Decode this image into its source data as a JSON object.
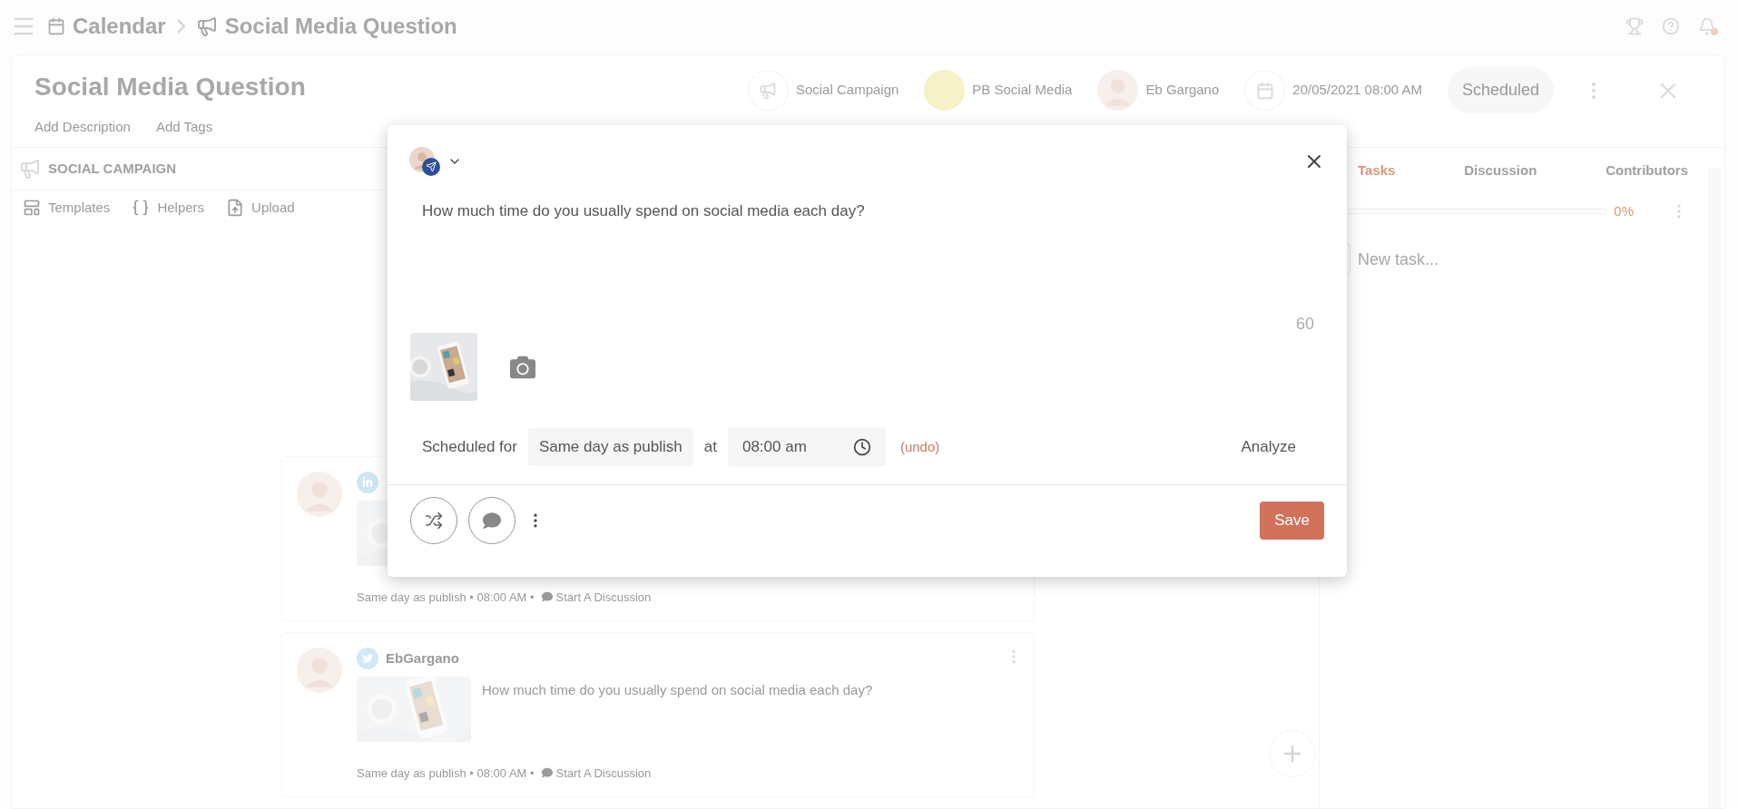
{
  "breadcrumb": [
    {
      "kind": "calendar",
      "label": "Calendar"
    },
    {
      "kind": "campaign",
      "label": "Social Media Question"
    }
  ],
  "page": {
    "title": "Social Media Question",
    "links": [
      "Add Description",
      "Add Tags"
    ]
  },
  "header_chips": [
    {
      "kind": "campaign",
      "label": "Social Campaign"
    },
    {
      "kind": "swatch",
      "label": "PB Social Media"
    },
    {
      "kind": "person",
      "label": "Eb Gargano"
    },
    {
      "kind": "date",
      "label": "20/05/2021 08:00 AM"
    }
  ],
  "status": "Scheduled",
  "section": {
    "title": "SOCIAL CAMPAIGN",
    "tools": [
      {
        "kind": "templates",
        "label": "Templates"
      },
      {
        "kind": "helpers",
        "label": "Helpers"
      },
      {
        "kind": "upload",
        "label": "Upload"
      }
    ]
  },
  "right_panel": {
    "tabs": [
      {
        "label": "Tasks",
        "selected": true
      },
      {
        "label": "Discussion",
        "selected": false
      },
      {
        "label": "Contributors",
        "selected": false
      }
    ],
    "progress": {
      "level": 0,
      "reading": "0%"
    },
    "new_task": {
      "checked": false,
      "placeholder": "New task..."
    }
  },
  "posts": [
    {
      "kind": "linkedin",
      "when": "Same day as publish • 08:00 AM •",
      "discuss": "Start A Discussion"
    },
    {
      "kind": "twitter",
      "menu": true,
      "name": "EbGargano",
      "text": "How much time do you usually spend on social media each day?",
      "when": "Same day as publish • 08:00 AM •",
      "discuss": "Start A Discussion"
    }
  ],
  "modal": {
    "text": "How much time do you usually spend on social media each day?",
    "count": "60",
    "schedule": {
      "label": "Scheduled for",
      "day": "Same day as publish",
      "at": "at",
      "time": "08:00 am",
      "undo": "(undo)"
    },
    "analyze": "Analyze",
    "save": "Save"
  }
}
